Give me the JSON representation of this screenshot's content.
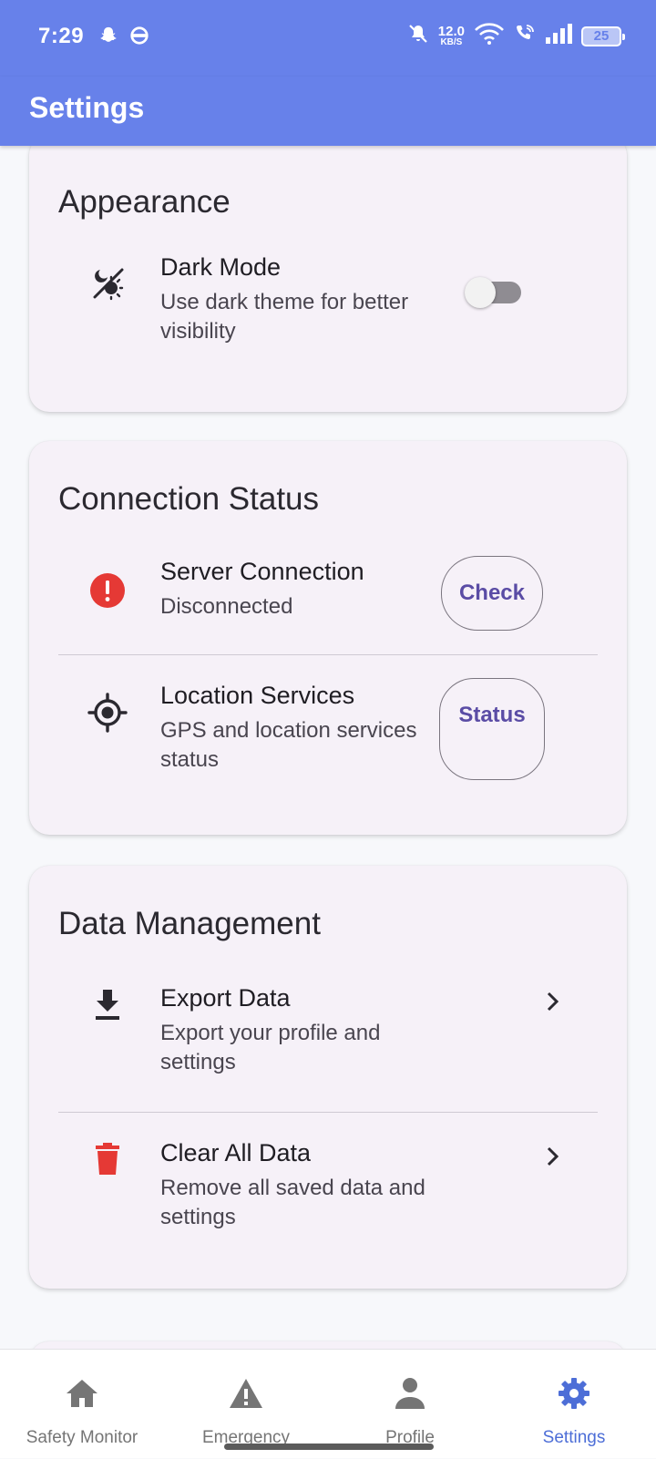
{
  "status_bar": {
    "time": "7:29",
    "net_speed_value": "12.0",
    "net_speed_unit": "KB/S",
    "battery": "25",
    "icons": [
      "snapchat-icon",
      "vpn-icon",
      "mute-bell-icon",
      "wifi-icon",
      "wifi-call-icon",
      "signal-icon",
      "battery-icon"
    ]
  },
  "app_bar": {
    "title": "Settings"
  },
  "appearance": {
    "title": "Appearance",
    "dark_mode": {
      "title": "Dark Mode",
      "subtitle": "Use dark theme for better visibility",
      "enabled": false,
      "icon": "dark-mode-icon"
    }
  },
  "connection_status": {
    "title": "Connection Status",
    "server": {
      "title": "Server Connection",
      "subtitle": "Disconnected",
      "button": "Check",
      "icon": "error-icon",
      "icon_color": "#e53935"
    },
    "location": {
      "title": "Location Services",
      "subtitle": "GPS and location services status",
      "button": "Status",
      "icon": "gps-icon"
    }
  },
  "data_management": {
    "title": "Data Management",
    "export": {
      "title": "Export Data",
      "subtitle": "Export your profile and settings",
      "icon": "download-icon"
    },
    "clear": {
      "title": "Clear All Data",
      "subtitle": "Remove all saved data and settings",
      "icon": "trash-icon",
      "icon_color": "#e53935"
    }
  },
  "bottom_nav": {
    "items": [
      {
        "label": "Safety Monitor",
        "icon": "home-icon"
      },
      {
        "label": "Emergency",
        "icon": "warning-icon"
      },
      {
        "label": "Profile",
        "icon": "person-icon"
      },
      {
        "label": "Settings",
        "icon": "gear-icon",
        "active": true
      }
    ],
    "active_color": "#4d6ed7"
  },
  "colors": {
    "primary": "#6781ea",
    "card_bg": "#f6f1f8",
    "button_text": "#5a4ca5"
  }
}
